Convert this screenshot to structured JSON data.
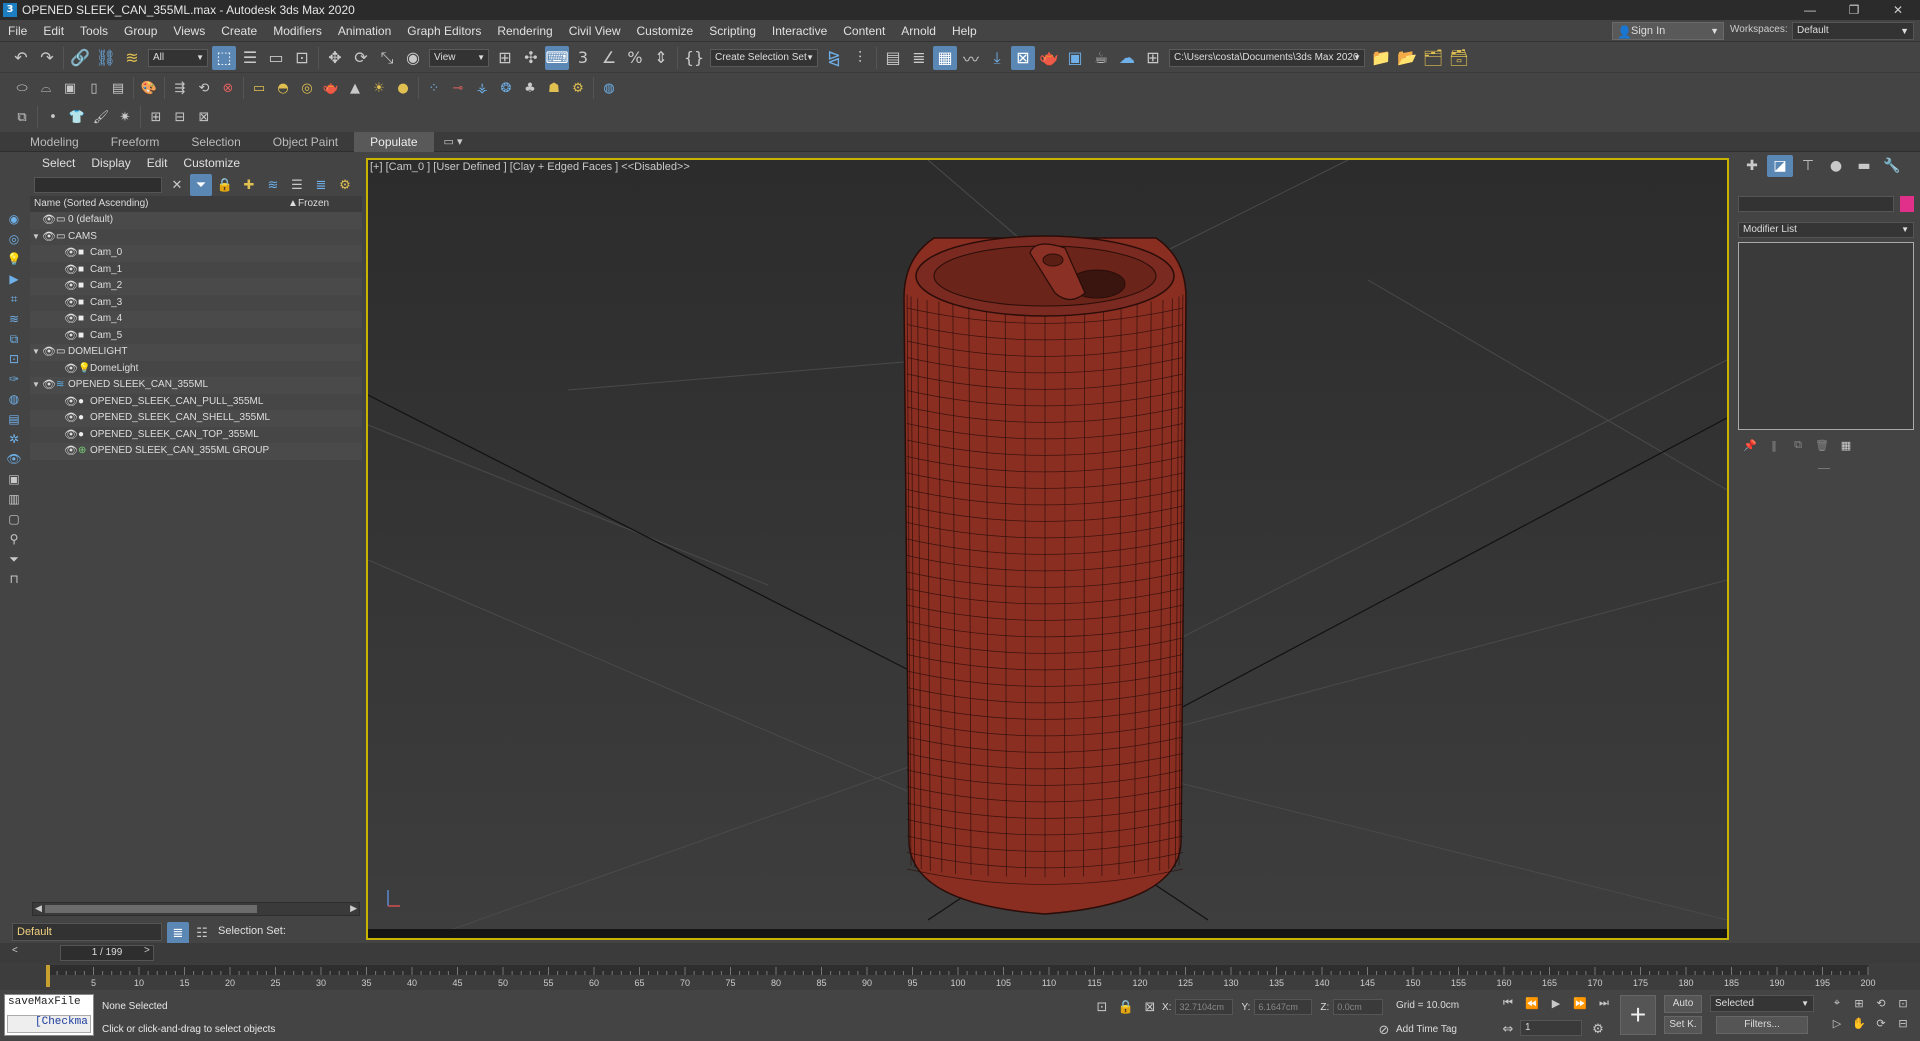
{
  "titlebar": {
    "app_icon": "3",
    "title": "OPENED SLEEK_CAN_355ML.max - Autodesk 3ds Max 2020",
    "min": "—",
    "restore": "❐",
    "close": "✕"
  },
  "menu": [
    "File",
    "Edit",
    "Tools",
    "Group",
    "Views",
    "Create",
    "Modifiers",
    "Animation",
    "Graph Editors",
    "Rendering",
    "Civil View",
    "Customize",
    "Scripting",
    "Interactive",
    "Content",
    "Arnold",
    "Help"
  ],
  "signin": {
    "label": "Sign In"
  },
  "workspaces": {
    "label": "Workspaces:",
    "value": "Default"
  },
  "toolbar": {
    "filter_value": "All",
    "refcoord_value": "View",
    "selset_value": "Create Selection Set",
    "path_value": "C:\\Users\\costa\\Documents\\3ds Max 2020"
  },
  "ribbon": {
    "tabs": [
      "Modeling",
      "Freeform",
      "Selection",
      "Object Paint",
      "Populate"
    ],
    "active": "Populate"
  },
  "scene_explorer": {
    "tabs": [
      "Select",
      "Display",
      "Edit",
      "Customize"
    ],
    "col_name": "Name (Sorted Ascending)",
    "col_sort": "▲",
    "col_frozen": "Frozen",
    "nodes": [
      {
        "label": "0 (default)",
        "indent": 0,
        "arrow": "",
        "icon": "layer"
      },
      {
        "label": "CAMS",
        "indent": 0,
        "arrow": "▼",
        "icon": "layer"
      },
      {
        "label": "Cam_0",
        "indent": 1,
        "arrow": "",
        "icon": "camera"
      },
      {
        "label": "Cam_1",
        "indent": 1,
        "arrow": "",
        "icon": "camera"
      },
      {
        "label": "Cam_2",
        "indent": 1,
        "arrow": "",
        "icon": "camera"
      },
      {
        "label": "Cam_3",
        "indent": 1,
        "arrow": "",
        "icon": "camera"
      },
      {
        "label": "Cam_4",
        "indent": 1,
        "arrow": "",
        "icon": "camera"
      },
      {
        "label": "Cam_5",
        "indent": 1,
        "arrow": "",
        "icon": "camera"
      },
      {
        "label": "DOMELIGHT",
        "indent": 0,
        "arrow": "▼",
        "icon": "layer"
      },
      {
        "label": "DomeLight",
        "indent": 1,
        "arrow": "",
        "icon": "light"
      },
      {
        "label": "OPENED SLEEK_CAN_355ML",
        "indent": 0,
        "arrow": "▼",
        "icon": "layers"
      },
      {
        "label": "OPENED_SLEEK_CAN_PULL_355ML",
        "indent": 1,
        "arrow": "",
        "icon": "geometry"
      },
      {
        "label": "OPENED_SLEEK_CAN_SHELL_355ML",
        "indent": 1,
        "arrow": "",
        "icon": "geometry"
      },
      {
        "label": "OPENED_SLEEK_CAN_TOP_355ML",
        "indent": 1,
        "arrow": "",
        "icon": "geometry"
      },
      {
        "label": "OPENED SLEEK_CAN_355ML GROUP",
        "indent": 1,
        "arrow": "",
        "icon": "group"
      }
    ]
  },
  "layer_bar": {
    "layer": "Default",
    "selection_set_label": "Selection Set:"
  },
  "viewport": {
    "label": "[+] [Cam_0 ] [User Defined ] [Clay + Edged Faces ]  <<Disabled>>",
    "can_color": "#8a2e22",
    "wire_color": "#2a0d08"
  },
  "command_panel": {
    "modifier_list": "Modifier List",
    "color_swatch": "#e0308a"
  },
  "timeline": {
    "frame": "1 / 199",
    "left_arrow": "<",
    "right_arrow": ">",
    "ticks": [
      5,
      10,
      15,
      20,
      25,
      30,
      35,
      40,
      45,
      50,
      55,
      60,
      65,
      70,
      75,
      80,
      85,
      90,
      95,
      100,
      105,
      110,
      115,
      120,
      125,
      130,
      135,
      140,
      145,
      150,
      155,
      160,
      165,
      170,
      175,
      180,
      185,
      190,
      195,
      200
    ],
    "start": 0
  },
  "status": {
    "maxscript_a": "saveMaxFile",
    "maxscript_b": "[Checkma",
    "selected": "None Selected",
    "hint": "Click or click-and-drag to select objects",
    "x_label": "X:",
    "x_value": "32.7104cm",
    "y_label": "Y:",
    "y_value": "6.1647cm",
    "z_label": "Z:",
    "z_value": "0.0cm",
    "grid": "Grid = 10.0cm",
    "time_tag": "Add Time Tag",
    "frame_field": "1",
    "auto": "Auto",
    "setk": "Set K.",
    "selected_dd": "Selected",
    "filters": "Filters..."
  }
}
